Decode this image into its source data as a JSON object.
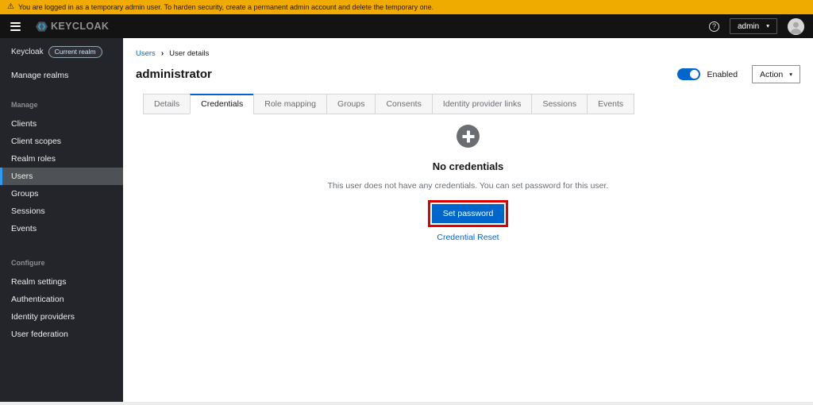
{
  "banner": {
    "text": "You are logged in as a temporary admin user. To harden security, create a permanent admin account and delete the temporary one."
  },
  "header": {
    "brand": "KEYCLOAK",
    "user_menu": "admin"
  },
  "icons": {
    "warning": "⚠",
    "help": "?",
    "caret_down": "▾",
    "breadcrumb_separator": "›"
  },
  "sidebar": {
    "realm_label": "Keycloak",
    "realm_badge": "Current realm",
    "manage_realms": "Manage realms",
    "sections": [
      {
        "label": "Manage",
        "items": [
          {
            "label": "Clients",
            "active": false
          },
          {
            "label": "Client scopes",
            "active": false
          },
          {
            "label": "Realm roles",
            "active": false
          },
          {
            "label": "Users",
            "active": true
          },
          {
            "label": "Groups",
            "active": false
          },
          {
            "label": "Sessions",
            "active": false
          },
          {
            "label": "Events",
            "active": false
          }
        ]
      },
      {
        "label": "Configure",
        "items": [
          {
            "label": "Realm settings",
            "active": false
          },
          {
            "label": "Authentication",
            "active": false
          },
          {
            "label": "Identity providers",
            "active": false
          },
          {
            "label": "User federation",
            "active": false
          }
        ]
      }
    ]
  },
  "breadcrumb": {
    "items": [
      "Users",
      "User details"
    ]
  },
  "page": {
    "title": "administrator",
    "enabled_label": "Enabled",
    "enabled_state": true,
    "action_label": "Action"
  },
  "tabs": [
    {
      "label": "Details",
      "active": false
    },
    {
      "label": "Credentials",
      "active": true
    },
    {
      "label": "Role mapping",
      "active": false
    },
    {
      "label": "Groups",
      "active": false
    },
    {
      "label": "Consents",
      "active": false
    },
    {
      "label": "Identity provider links",
      "active": false
    },
    {
      "label": "Sessions",
      "active": false
    },
    {
      "label": "Events",
      "active": false
    }
  ],
  "empty_state": {
    "title": "No credentials",
    "description": "This user does not have any credentials. You can set password for this user.",
    "button_label": "Set password",
    "link_label": "Credential Reset"
  },
  "colors": {
    "banner_bg": "#f0ab00",
    "accent_blue": "#0066cc",
    "nav_active_indicator": "#2b9af3",
    "annotation_highlight": "#dd0000"
  }
}
